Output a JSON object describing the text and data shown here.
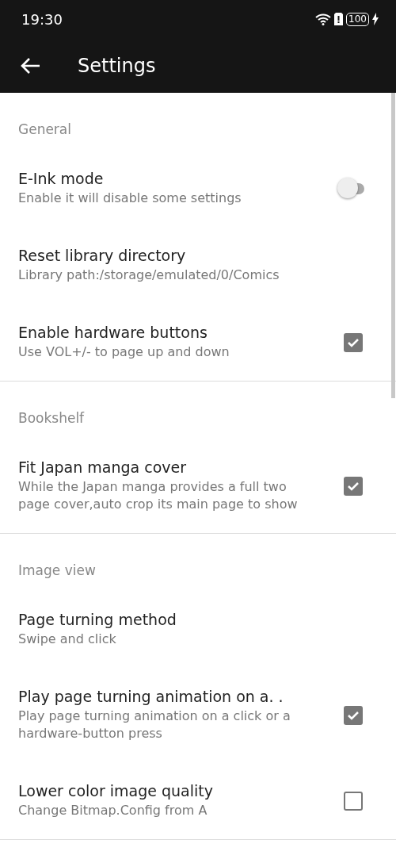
{
  "status_bar": {
    "time": "19:30",
    "battery": "100"
  },
  "toolbar": {
    "title": "Settings"
  },
  "sections": [
    {
      "header": "General",
      "items": [
        {
          "kind": "switch",
          "title": "E-Ink mode",
          "summary": "Enable it will disable some settings",
          "on": false
        },
        {
          "kind": "plain",
          "title": "Reset library directory",
          "summary": "Library path:/storage/emulated/0/Comics"
        },
        {
          "kind": "checkbox",
          "title": "Enable hardware buttons",
          "summary": "Use VOL+/- to page up and down",
          "checked": true
        }
      ]
    },
    {
      "header": "Bookshelf",
      "items": [
        {
          "kind": "checkbox",
          "title": "Fit Japan manga cover",
          "summary": "While the Japan manga provides a full two page cover,auto crop its main page to show",
          "checked": true
        }
      ]
    },
    {
      "header": "Image view",
      "items": [
        {
          "kind": "plain",
          "title": "Page turning method",
          "summary": "Swipe and click"
        },
        {
          "kind": "checkbox",
          "title": "Play page turning animation on a. .",
          "summary": "Play page turning animation on a click or a hardware-button press",
          "checked": true
        },
        {
          "kind": "checkbox",
          "title": "Lower color image quality",
          "summary": "Change Bitmap.Config from A",
          "checked": false
        }
      ]
    }
  ]
}
